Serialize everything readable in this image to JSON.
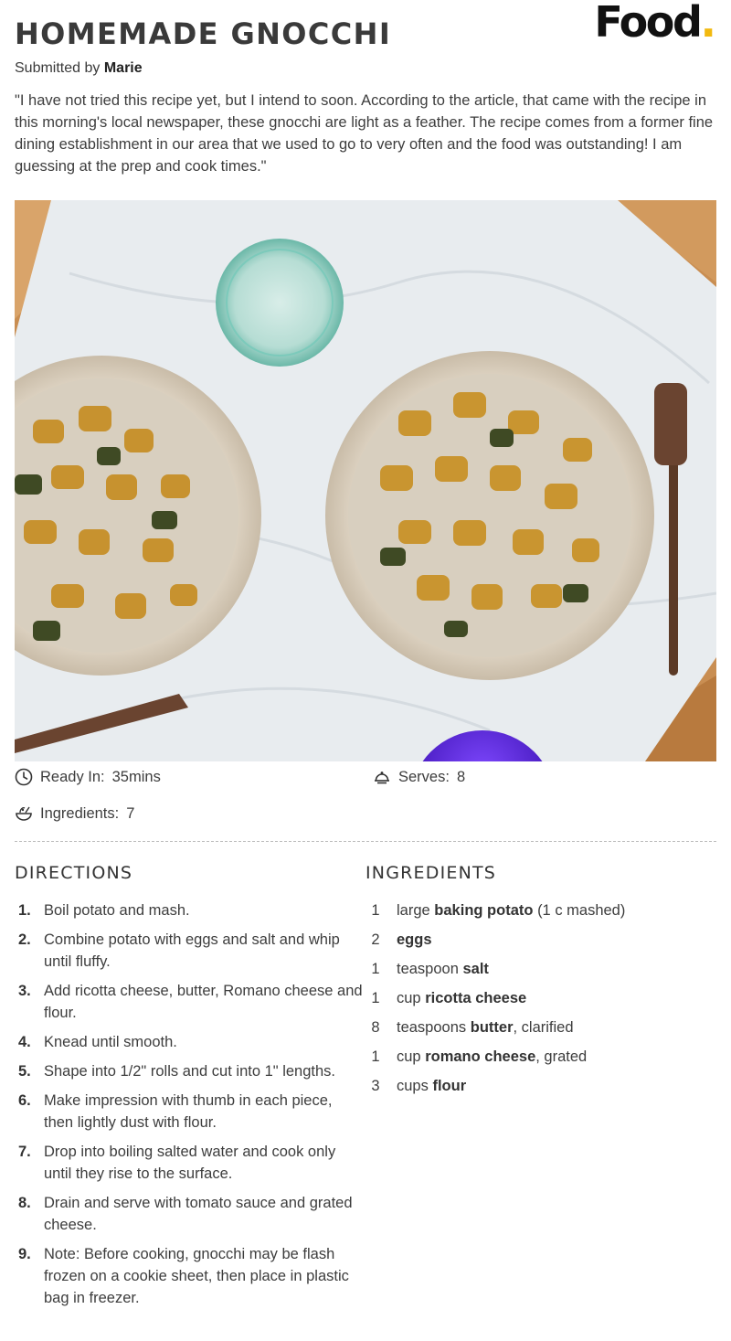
{
  "recipe": {
    "title": "HOMEMADE GNOCCHI",
    "submitted_prefix": "Submitted by",
    "author": "Marie",
    "description": "\"I have not tried this recipe yet, but I intend to soon. According to the article, that came with the recipe in this morning's local newspaper, these gnocchi are light as a feather. The recipe comes from a former fine dining establishment in our area that we used to go to very often and the food was outstanding! I am guessing at the prep and cook times.\""
  },
  "logo": {
    "text": "Food",
    "dot": ".",
    "dot_color": "#f2b90f"
  },
  "meta": {
    "ready_label": "Ready In:",
    "ready_value": "35mins",
    "serves_label": "Serves:",
    "serves_value": "8",
    "ingredients_label": "Ingredients:",
    "ingredients_value": "7"
  },
  "icons": [
    "clock-icon",
    "serving-dish-icon",
    "ingredients-bowl-icon"
  ],
  "sections": {
    "directions": "DIRECTIONS",
    "ingredients": "INGREDIENTS"
  },
  "directions": [
    "Boil potato and mash.",
    "Combine potato with eggs and salt and whip until fluffy.",
    "Add ricotta cheese, butter, Romano cheese and flour.",
    "Knead until smooth.",
    "Shape into 1/2\" rolls and cut into 1\" lengths.",
    "Make impression with thumb in each piece, then lightly dust with flour.",
    "Drop into boiling salted water and cook only until they rise to the surface.",
    "Drain and serve with tomato sauce and grated cheese.",
    "Note: Before cooking, gnocchi may be flash frozen on a cookie sheet, then place in plastic bag in freezer."
  ],
  "ingredients": [
    {
      "qty": "1",
      "unit": "large",
      "name": "baking potato",
      "note": "(1 c mashed)"
    },
    {
      "qty": "2",
      "unit": "",
      "name": "eggs",
      "note": ""
    },
    {
      "qty": "1",
      "unit": "teaspoon",
      "name": "salt",
      "note": ""
    },
    {
      "qty": "1",
      "unit": "cup",
      "name": "ricotta cheese",
      "note": ""
    },
    {
      "qty": "8",
      "unit": "teaspoons",
      "name": "butter",
      "note": ", clarified"
    },
    {
      "qty": "1",
      "unit": "cup",
      "name": "romano cheese",
      "note": ", grated"
    },
    {
      "qty": "3",
      "unit": "cups",
      "name": "flour",
      "note": ""
    }
  ]
}
